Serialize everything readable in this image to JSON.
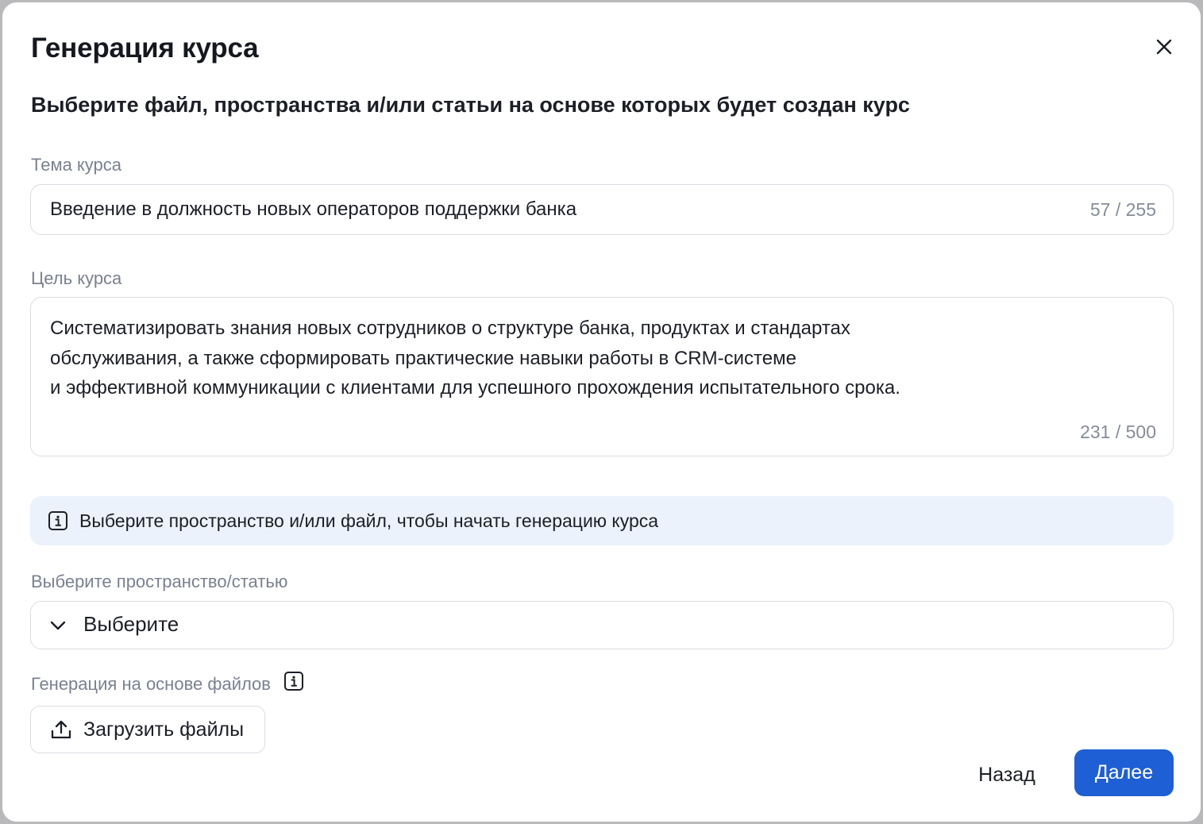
{
  "dialog": {
    "title": "Генерация курса",
    "subtitle": "Выберите файл, пространства и/или статьи на основе которых будет создан курс"
  },
  "topic": {
    "label": "Тема курса",
    "value": "Введение в должность новых операторов поддержки банка",
    "counter": "57 / 255"
  },
  "goal": {
    "label": "Цель курса",
    "lines": [
      "Систематизировать знания новых сотрудников о структуре банка, продуктах и стандартах",
      "обслуживания, а также сформировать практические навыки работы в CRM-системе",
      "и эффективной коммуникации с клиентами для успешного прохождения испытательного срока."
    ],
    "counter": "231 / 500"
  },
  "info_banner": {
    "icon": "info-icon",
    "text": "Выберите пространство и/или файл, чтобы начать генерацию курса"
  },
  "space_select": {
    "label": "Выберите пространство/статью",
    "icon": "chevron-down-icon",
    "value": "Выберите"
  },
  "files": {
    "label": "Генерация на основе файлов",
    "info_icon": "info-icon",
    "upload_icon": "upload-icon",
    "upload_label": "Загрузить файлы"
  },
  "footer": {
    "back_label": "Назад",
    "next_label": "Далее"
  },
  "colors": {
    "primary": "#1f5fd6",
    "info_background": "#ebf2fc",
    "muted_text": "#7a8190",
    "border": "#dadde3"
  }
}
